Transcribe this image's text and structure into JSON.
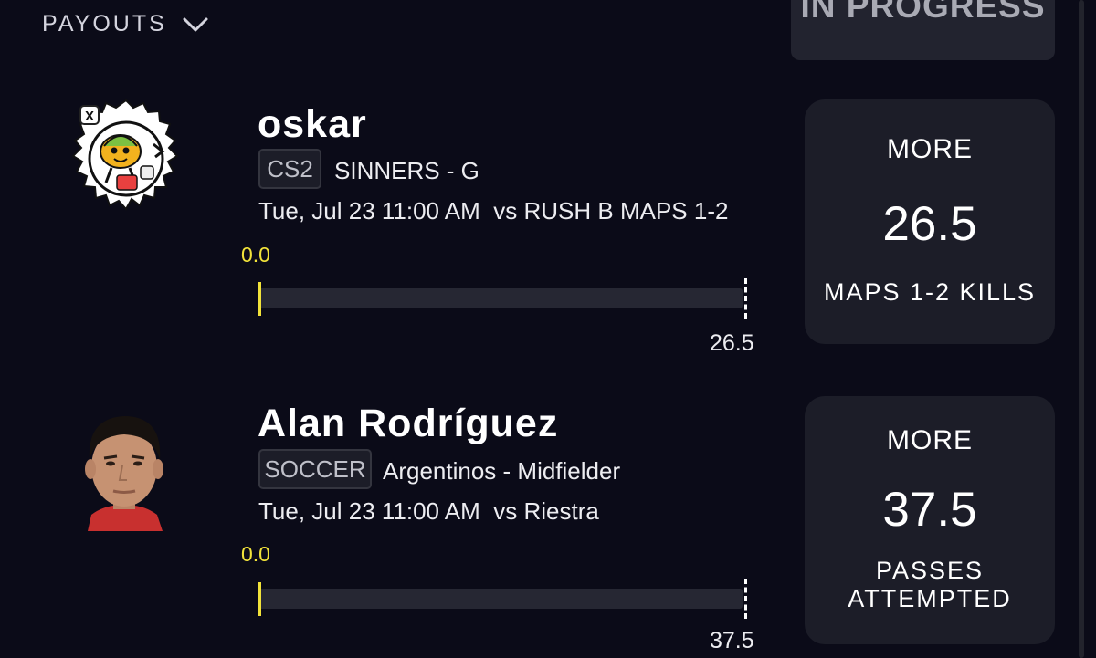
{
  "header": {
    "payouts_label": "PAYOUTS",
    "status_label": "IN PROGRESS"
  },
  "picks": [
    {
      "player_name": "oskar",
      "league": "CS2",
      "team_position": "SINNERS - G",
      "game_time": "Tue, Jul 23 11:00 AM",
      "opponent": "vs RUSH B MAPS 1-2",
      "current_value": "0.0",
      "progress": 0.0,
      "target_value": "26.5",
      "direction": "MORE",
      "line": "26.5",
      "stat_lines": [
        "MAPS 1-2 KILLS"
      ],
      "avatar": "x-voted-sticker-badge"
    },
    {
      "player_name": "Alan Rodríguez",
      "league": "SOCCER",
      "team_position": "Argentinos - Midfielder",
      "game_time": "Tue, Jul 23 11:00 AM",
      "opponent": "vs Riestra",
      "current_value": "0.0",
      "progress": 0.0,
      "target_value": "37.5",
      "direction": "MORE",
      "line": "37.5",
      "stat_lines": [
        "PASSES",
        "ATTEMPTED"
      ],
      "avatar": "player-headshot"
    }
  ],
  "colors": {
    "background": "#0b0b18",
    "card": "#1c1d28",
    "accent_yellow": "#f2e33a",
    "muted": "#a9aab4"
  },
  "icons": {
    "dropdown": "chevron-down-icon",
    "badge_x": "x-logo-icon"
  }
}
